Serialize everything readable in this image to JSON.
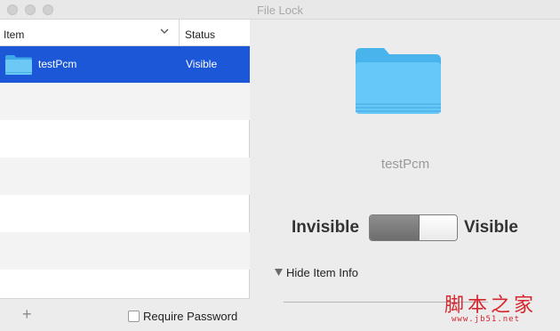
{
  "window": {
    "title": "File Lock"
  },
  "table": {
    "columns": {
      "item": "Item",
      "status": "Status"
    },
    "rows": [
      {
        "name": "testPcm",
        "status": "Visible",
        "icon": "folder-icon",
        "selected": true
      }
    ]
  },
  "footer": {
    "add_icon": "plus-icon",
    "require_password_label": "Require Password",
    "require_password_checked": false
  },
  "detail": {
    "item_name": "testPcm",
    "invisible_label": "Invisible",
    "visible_label": "Visible",
    "toggle_state": "Visible",
    "hide_info_label": "Hide Item Info"
  },
  "watermark": {
    "main": "脚本之家",
    "sub": "www.jb51.net"
  },
  "colors": {
    "selection": "#1c57d8",
    "folder": "#5fc3f3",
    "window_bg": "#ececec",
    "watermark": "#d6262e"
  }
}
